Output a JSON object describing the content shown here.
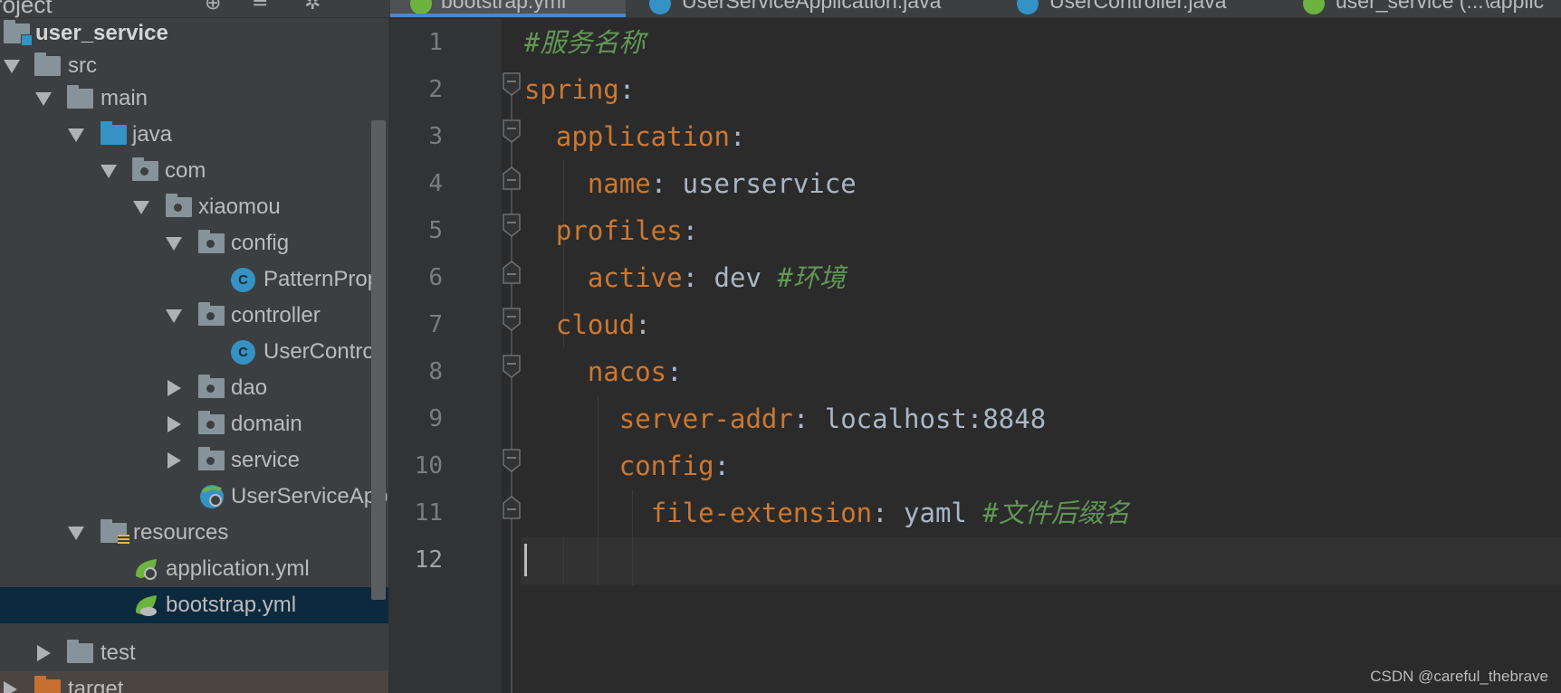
{
  "project_panel": {
    "header_title": "roject",
    "tree": [
      {
        "label": "user_service",
        "bold": true
      },
      {
        "label": "src"
      },
      {
        "label": "main"
      },
      {
        "label": "java"
      },
      {
        "label": "com"
      },
      {
        "label": "xiaomou"
      },
      {
        "label": "config"
      },
      {
        "label": "PatternProp"
      },
      {
        "label": "controller"
      },
      {
        "label": "UserControl"
      },
      {
        "label": "dao"
      },
      {
        "label": "domain"
      },
      {
        "label": "service"
      },
      {
        "label": "UserServiceApp"
      },
      {
        "label": "resources"
      },
      {
        "label": "application.yml"
      },
      {
        "label": "bootstrap.yml",
        "selected": true
      },
      {
        "label": "test"
      },
      {
        "label": "target"
      }
    ]
  },
  "tabs": [
    {
      "label": "bootstrap.yml",
      "active": true
    },
    {
      "label": "UserServiceApplication.java"
    },
    {
      "label": "UserController.java"
    },
    {
      "label": "user_service (...\\applic"
    }
  ],
  "editor": {
    "line_numbers": [
      "1",
      "2",
      "3",
      "4",
      "5",
      "6",
      "7",
      "8",
      "9",
      "10",
      "11",
      "12"
    ],
    "current_line": "12",
    "lines": [
      {
        "comment": "#服务名称"
      },
      {
        "key": "spring",
        "colon": ":"
      },
      {
        "key": "application",
        "colon": ":"
      },
      {
        "key": "name",
        "colon": ": ",
        "value": "userservice"
      },
      {
        "key": "profiles",
        "colon": ":"
      },
      {
        "key": "active",
        "colon": ": ",
        "value": "dev ",
        "comment": "#环境"
      },
      {
        "key": "cloud",
        "colon": ":"
      },
      {
        "key": "nacos",
        "colon": ":"
      },
      {
        "key": "server-addr",
        "colon": ": ",
        "value": "localhost:8848"
      },
      {
        "key": "config",
        "colon": ":"
      },
      {
        "key": "file-extension",
        "colon": ": ",
        "value": "yaml ",
        "comment": "#文件后缀名"
      },
      {}
    ]
  },
  "watermark": "CSDN @careful_thebrave",
  "colors": {
    "keyword": "#cc7832",
    "comment": "#629755",
    "text": "#a9b7c6",
    "selection": "#0d293e",
    "accent": "#4a88c7"
  }
}
